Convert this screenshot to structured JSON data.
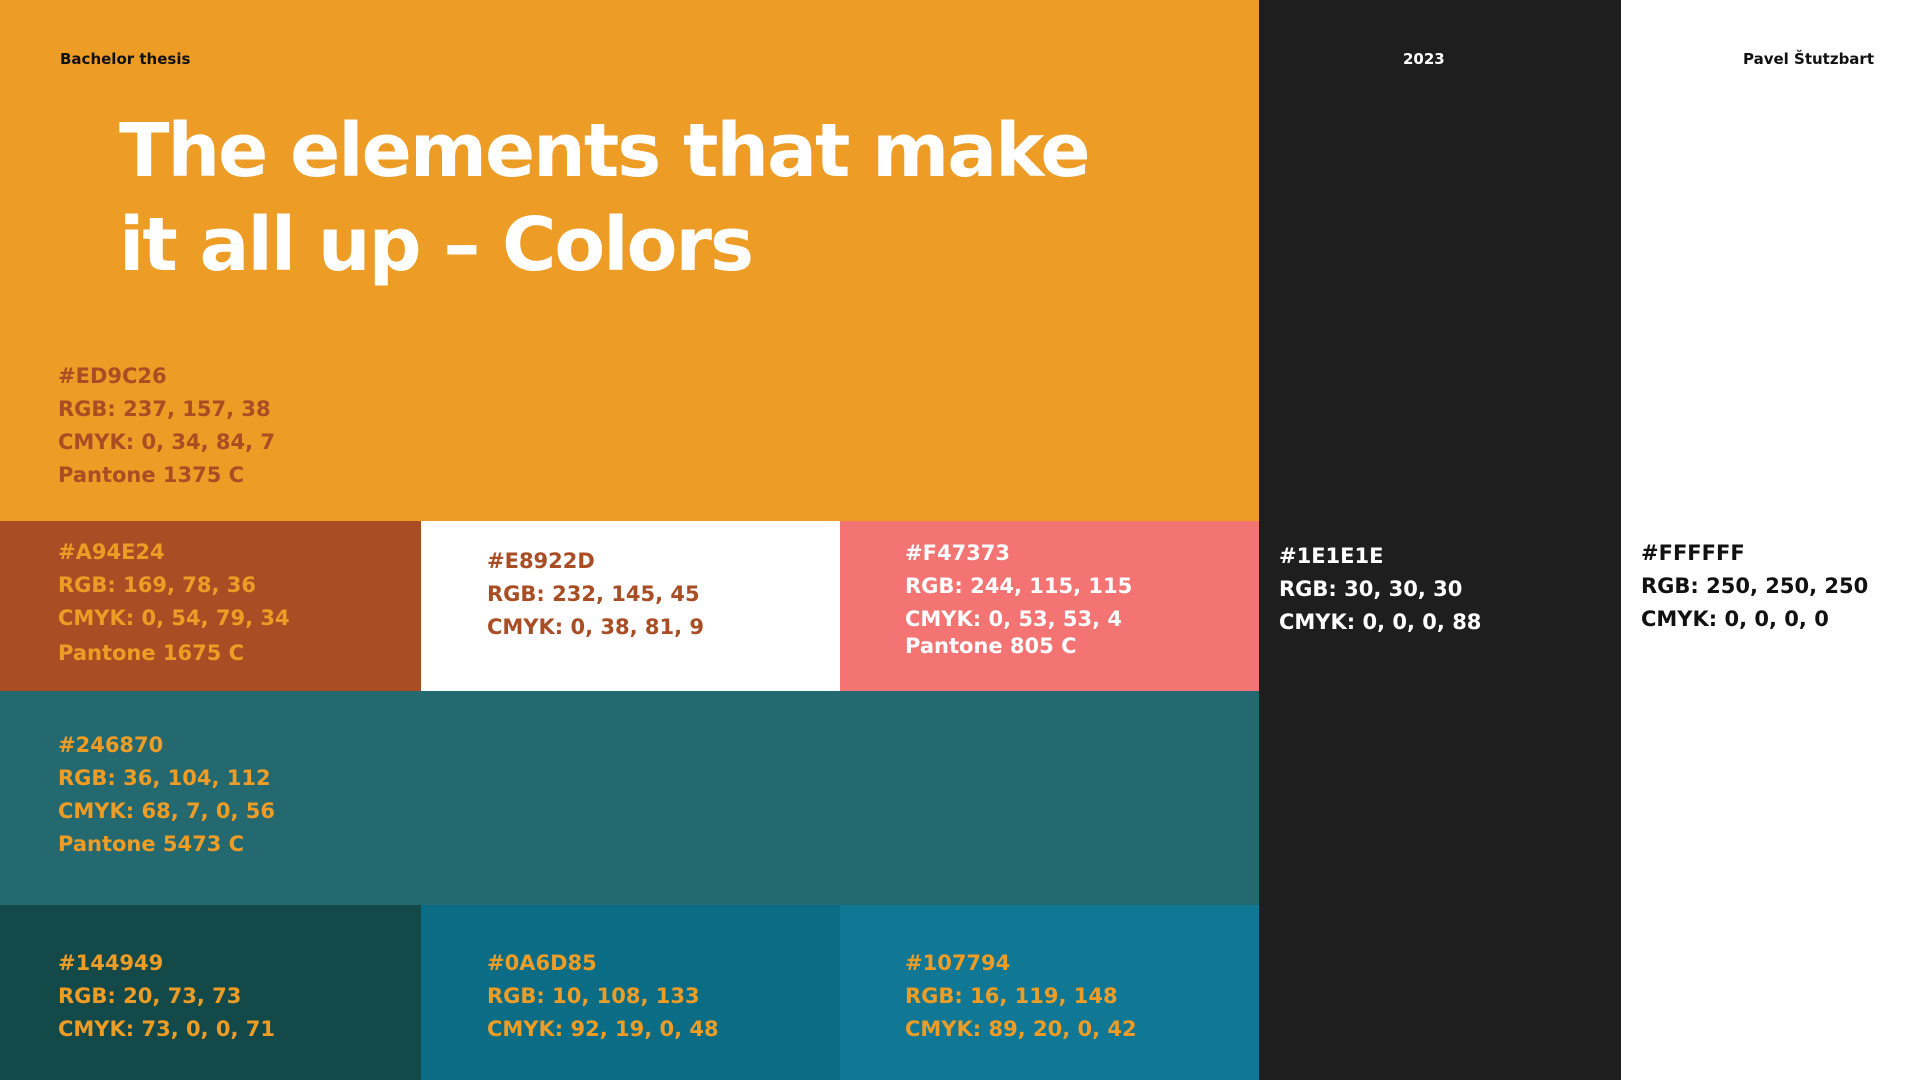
{
  "header": {
    "left_label": "Bachelor thesis",
    "year": "2023",
    "author": "Pavel Štutzbart"
  },
  "title": {
    "line1": "The elements that make",
    "line2": "it all up – Colors"
  },
  "swatches": {
    "orange": {
      "color": "#ED9C26",
      "text_color": "#A94E24",
      "hex": "#ED9C26",
      "rgb": "RGB: 237, 157, 38",
      "cmyk": "CMYK: 0, 34, 84, 7",
      "pantone": "Pantone 1375 C"
    },
    "rust": {
      "color": "#A94E24",
      "text_color": "#ED9C26",
      "hex": "#A94E24",
      "rgb": "RGB: 169, 78, 36",
      "cmyk": "CMYK: 0, 54, 79, 34",
      "pantone": "Pantone 1675 C"
    },
    "white_orange": {
      "color": "#FFFFFF",
      "text_color": "#A94E24",
      "hex": "#E8922D",
      "rgb": "RGB: 232, 145, 45",
      "cmyk": "CMYK: 0, 38, 81, 9"
    },
    "pink": {
      "color": "#F47373",
      "text_color": "#FFFFFF",
      "hex": "#F47373",
      "rgb": "RGB: 244, 115, 115",
      "cmyk": "CMYK: 0, 53, 53, 4",
      "pantone": "Pantone 805 C"
    },
    "black": {
      "color": "#1E1E1E",
      "text_color": "#FFFFFF",
      "hex": "#1E1E1E",
      "rgb": "RGB: 30, 30, 30",
      "cmyk": "CMYK: 0, 0, 0, 88"
    },
    "white": {
      "color": "#FFFFFF",
      "text_color": "#111111",
      "hex": "#FFFFFF",
      "rgb": "RGB: 250, 250, 250",
      "cmyk": "CMYK: 0, 0, 0, 0"
    },
    "teal": {
      "color": "#246870",
      "text_color": "#ED9C26",
      "hex": "#246870",
      "rgb": "RGB: 36, 104, 112",
      "cmyk": "CMYK: 68, 7, 0, 56",
      "pantone": "Pantone 5473 C"
    },
    "dark_teal": {
      "color": "#144949",
      "text_color": "#ED9C26",
      "hex": "#144949",
      "rgb": "RGB: 20, 73, 73",
      "cmyk": "CMYK: 73, 0, 0, 71"
    },
    "blue1": {
      "color": "#0A6D85",
      "text_color": "#ED9C26",
      "hex": "#0A6D85",
      "rgb": "RGB: 10, 108, 133",
      "cmyk": "CMYK: 92, 19, 0, 48"
    },
    "blue2": {
      "color": "#107794",
      "text_color": "#ED9C26",
      "hex": "#107794",
      "rgb": "RGB: 16, 119, 148",
      "cmyk": "CMYK: 89, 20, 0, 42"
    }
  }
}
